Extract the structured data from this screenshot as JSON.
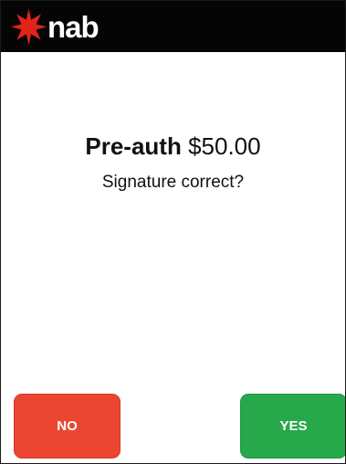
{
  "header": {
    "brand": "nab",
    "logo_icon": "nab-star-icon",
    "background": "#050505",
    "star_color": "#e2231a"
  },
  "prompt": {
    "label": "Pre-auth",
    "amount": "$50.00",
    "question": "Signature correct?"
  },
  "buttons": {
    "no_label": "NO",
    "yes_label": "YES",
    "no_color": "#ea4632",
    "yes_color": "#27a84b"
  }
}
